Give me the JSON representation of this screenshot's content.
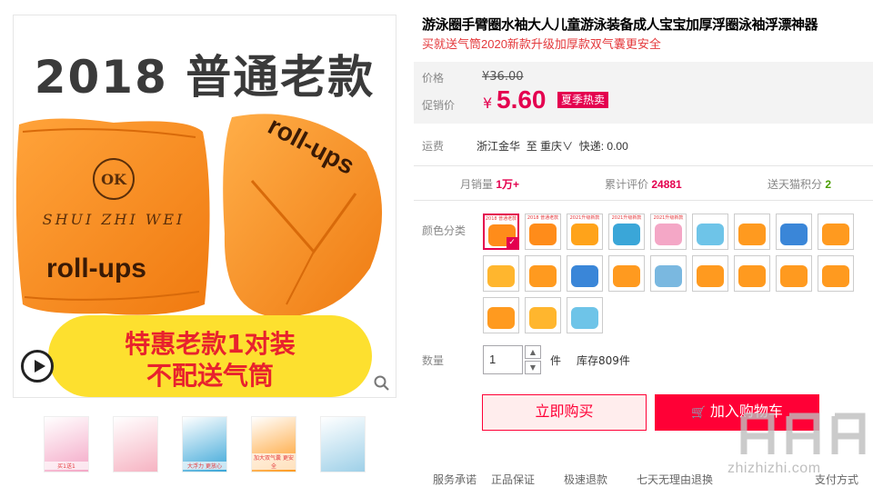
{
  "gallery": {
    "headline": "2018   普通老款",
    "banner_line1": "特惠老款1对装",
    "banner_line2": "不配送气筒",
    "print_top": "roll-ups",
    "print_left": "roll-ups",
    "badge_text": "OK",
    "ring_text": "SHUI ZHI WEI",
    "thumbnails": [
      {
        "caption": "买1送1",
        "color": "#f4a7c6"
      },
      {
        "caption": "",
        "color": "#f6b3c2"
      },
      {
        "caption": "大浮力 更放心",
        "color": "#3aa6d8"
      },
      {
        "caption": "加大双气囊 更安全",
        "color": "#ff9a1f"
      },
      {
        "caption": "",
        "color": "#9ed0e8"
      }
    ]
  },
  "product": {
    "title": "游泳圈手臂圈水袖大人儿童游泳装备成人宝宝加厚浮圈泳袖浮漂神器",
    "subtitle": "买就送气筒2020新款升级加厚款双气囊更安全"
  },
  "price": {
    "orig_label": "价格",
    "orig_value": "¥36.00",
    "promo_label": "促销价",
    "promo_currency": "¥",
    "promo_value": "5.60",
    "promo_tag": "夏季热卖"
  },
  "shipping": {
    "label": "运费",
    "from": "浙江金华",
    "to_word": "至",
    "to": "重庆",
    "express": "快递: 0.00"
  },
  "stats": {
    "monthly_label": "月销量",
    "monthly_value": "1万+",
    "reviews_label": "累计评价",
    "reviews_value": "24881",
    "points_label": "送天猫积分",
    "points_value": "2"
  },
  "sku": {
    "label": "颜色分类",
    "items": [
      {
        "caption": "2018 普通老款",
        "color": "#ff8c1a"
      },
      {
        "caption": "2018 普通老款",
        "color": "#ff8c1a"
      },
      {
        "caption": "2021升级新款",
        "color": "#ffa31a"
      },
      {
        "caption": "2021升级新款",
        "color": "#3aa6d8"
      },
      {
        "caption": "2021升级新款",
        "color": "#f4a7c6"
      },
      {
        "caption": "",
        "color": "#6ec4e8"
      },
      {
        "caption": "",
        "color": "#ff9a1f"
      },
      {
        "caption": "",
        "color": "#3a86d8"
      },
      {
        "caption": "",
        "color": "#ff9a1f"
      },
      {
        "caption": "",
        "color": "#ffb62e"
      },
      {
        "caption": "",
        "color": "#ff9a1f"
      },
      {
        "caption": "",
        "color": "#3a86d8"
      },
      {
        "caption": "",
        "color": "#ff9a1f"
      },
      {
        "caption": "",
        "color": "#7ab8e0"
      },
      {
        "caption": "",
        "color": "#ff9a1f"
      },
      {
        "caption": "",
        "color": "#ff9a1f"
      },
      {
        "caption": "",
        "color": "#ff9a1f"
      },
      {
        "caption": "",
        "color": "#ff9a1f"
      },
      {
        "caption": "",
        "color": "#ff9a1f"
      },
      {
        "caption": "",
        "color": "#ffb62e"
      },
      {
        "caption": "",
        "color": "#6ec4e8"
      }
    ],
    "selected_index": 0
  },
  "quantity": {
    "label": "数量",
    "value": "1",
    "unit": "件",
    "stock": "库存809件"
  },
  "actions": {
    "buy_now": "立即购买",
    "add_cart": "加入购物车"
  },
  "bottom": {
    "service_label": "服务承诺",
    "item1": "正品保证",
    "item2": "极速退款",
    "item3": "七天无理由退换",
    "pay_label": "支付方式"
  },
  "watermark": "zhizhizhi.com",
  "colors": {
    "accent": "#ff0036",
    "price": "#e4004f",
    "orange": "#ff8c1a"
  }
}
